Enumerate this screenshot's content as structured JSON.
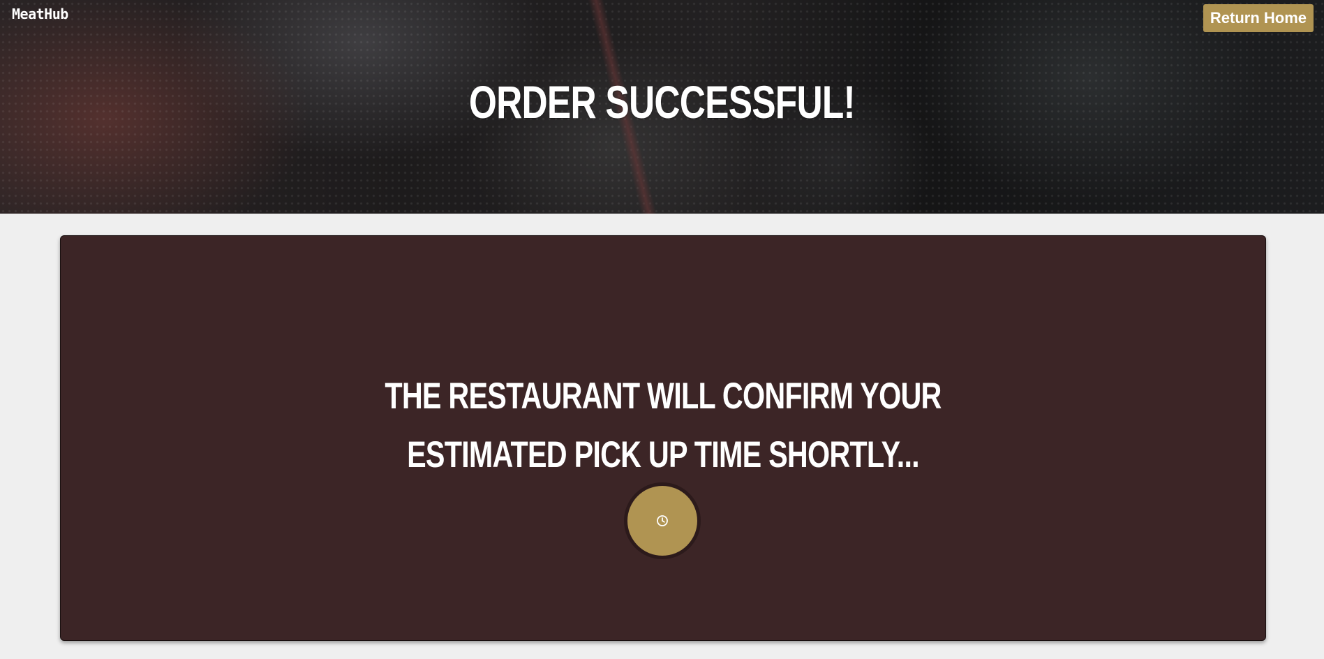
{
  "header": {
    "brand": "MeatHub",
    "return_label": "Return Home",
    "title": "ORDER SUCCESSFUL!"
  },
  "main": {
    "message_line_1": "THE RESTAURANT WILL CONFIRM YOUR",
    "message_line_2": "ESTIMATED PICK UP TIME SHORTLY...",
    "status_icon": "clock-icon"
  },
  "colors": {
    "accent": "#b09452",
    "card_background": "#3c2526",
    "page_background": "#efefef",
    "text": "#ffffff"
  }
}
